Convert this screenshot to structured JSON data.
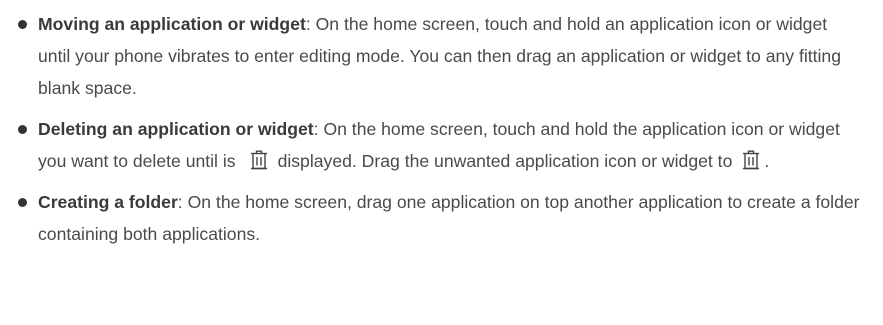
{
  "items": [
    {
      "term": "Moving an application or widget",
      "text": ": On the home screen, touch and hold an application icon or widget until your phone vibrates to enter editing mode. You can then drag an application or widget to any fitting blank space."
    },
    {
      "term": "Deleting an application or widget",
      "text_a": ": On the home screen, touch and hold the application icon or widget you want to delete until is",
      "icon_a": "trash-icon",
      "text_b": "displayed. Drag the unwanted application icon or widget to",
      "icon_b": "trash-icon",
      "text_c": "."
    },
    {
      "term": "Creating a folder",
      "text": ": On the home screen, drag one application on top another application to create a folder containing both applications."
    }
  ]
}
